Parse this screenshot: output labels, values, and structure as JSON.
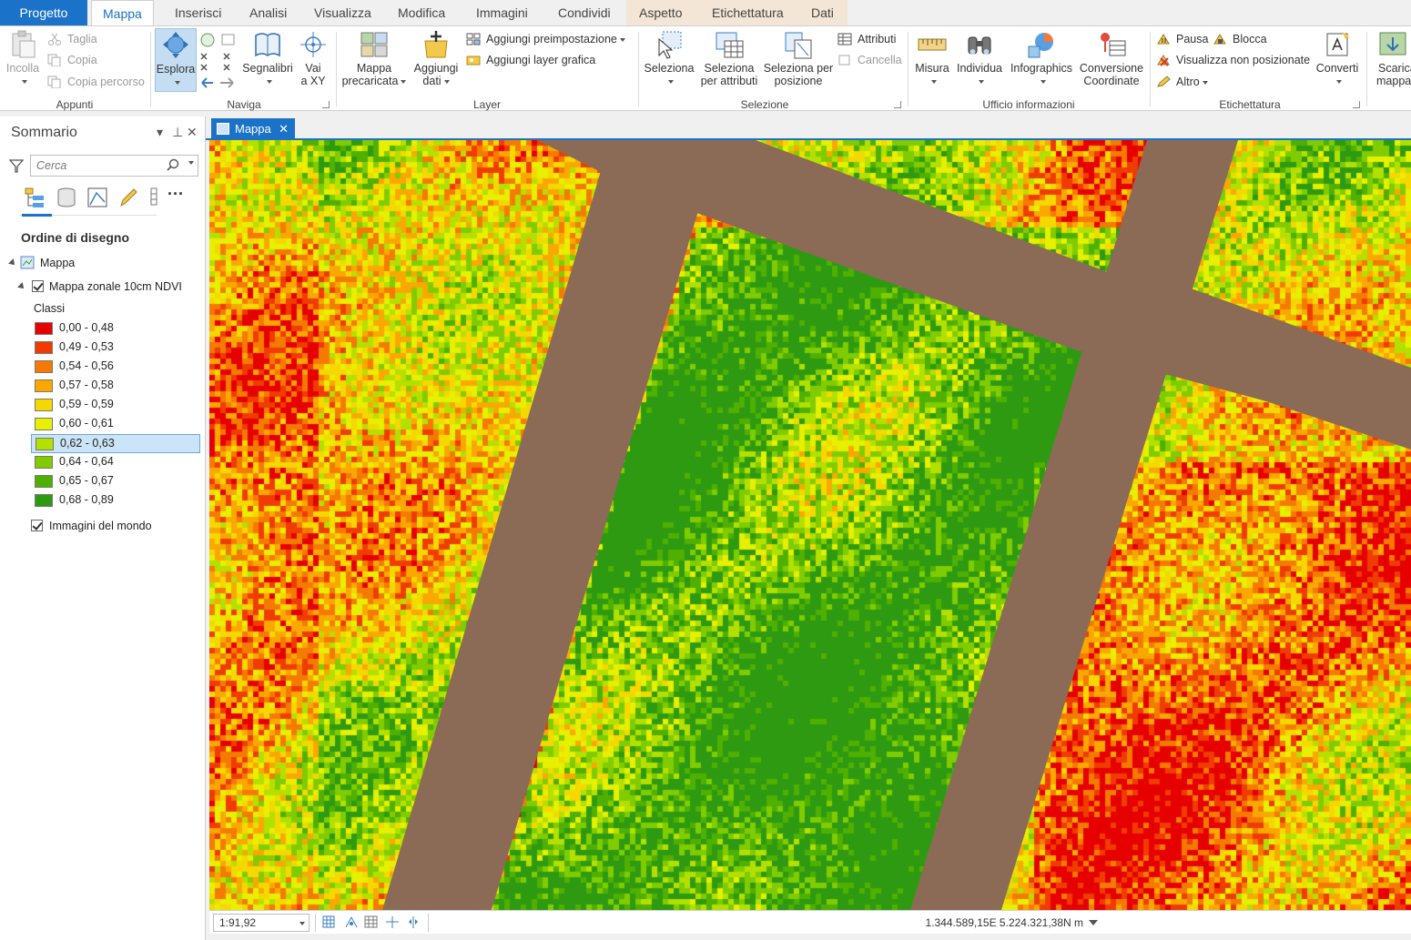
{
  "tabs": [
    {
      "label": "Progetto"
    },
    {
      "label": "Mappa"
    },
    {
      "label": "Inserisci"
    },
    {
      "label": "Analisi"
    },
    {
      "label": "Visualizza"
    },
    {
      "label": "Modifica"
    },
    {
      "label": "Immagini"
    },
    {
      "label": "Condividi"
    },
    {
      "label": "Aspetto"
    },
    {
      "label": "Etichettatura"
    },
    {
      "label": "Dati"
    }
  ],
  "ribbon": {
    "appunti": {
      "label": "Appunti",
      "paste": "Incolla",
      "cut": "Taglia",
      "copy": "Copia",
      "copy_path": "Copia percorso"
    },
    "naviga": {
      "label": "Naviga",
      "explore": "Esplora",
      "bookmarks": "Segnalibri",
      "goto_1": "Vai",
      "goto_2": "a XY"
    },
    "layer": {
      "label": "Layer",
      "basemap_1": "Mappa",
      "basemap_2": "precaricata",
      "add_data_1": "Aggiungi",
      "add_data_2": "dati",
      "add_preset": "Aggiungi preimpostazione",
      "add_graphics": "Aggiungi layer grafica"
    },
    "selezione": {
      "label": "Selezione",
      "select": "Seleziona",
      "by_attr_1": "Seleziona",
      "by_attr_2": "per attributi",
      "by_loc_1": "Seleziona per",
      "by_loc_2": "posizione",
      "attributes": "Attributi",
      "clear": "Cancella"
    },
    "ufficio": {
      "label": "Ufficio informazioni",
      "measure": "Misura",
      "identify": "Individua",
      "infographics": "Infographics",
      "convert_1": "Conversione",
      "convert_2": "Coordinate"
    },
    "etichettatura": {
      "label": "Etichettatura",
      "pause": "Pausa",
      "lock": "Blocca",
      "unplaced": "Visualizza non posizionate",
      "more": "Altro",
      "convert": "Converti"
    },
    "download": {
      "label_1": "Scarica",
      "label_2": "mappa"
    }
  },
  "contents": {
    "title": "Sommario",
    "search_placeholder": "Cerca",
    "section": "Ordine di disegno",
    "map_name": "Mappa",
    "layer_name": "Mappa zonale 10cm NDVI",
    "classes_label": "Classi",
    "classes": [
      {
        "label": "0,00 - 0,48",
        "color": "#e60000"
      },
      {
        "label": "0,49 - 0,53",
        "color": "#f03c00"
      },
      {
        "label": "0,54 - 0,56",
        "color": "#f57a00"
      },
      {
        "label": "0,57 - 0,58",
        "color": "#faa800"
      },
      {
        "label": "0,59 - 0,59",
        "color": "#f5d800"
      },
      {
        "label": "0,60 - 0,61",
        "color": "#e6f000"
      },
      {
        "label": "0,62 - 0,63",
        "color": "#b4e000"
      },
      {
        "label": "0,64 - 0,64",
        "color": "#80cc00"
      },
      {
        "label": "0,65 - 0,67",
        "color": "#4fb000"
      },
      {
        "label": "0,68 - 0,89",
        "color": "#2e9a12"
      }
    ],
    "selected_class": 6,
    "basemap_layer": "Immagini del mondo"
  },
  "map_tab": {
    "label": "Mappa",
    "close": "✕"
  },
  "status": {
    "scale": "1:91,92",
    "coords": "1.344.589,15E 5.224.321,38N m"
  },
  "colors": {
    "accent": "#1b72c9",
    "road": "#8b6b55"
  }
}
